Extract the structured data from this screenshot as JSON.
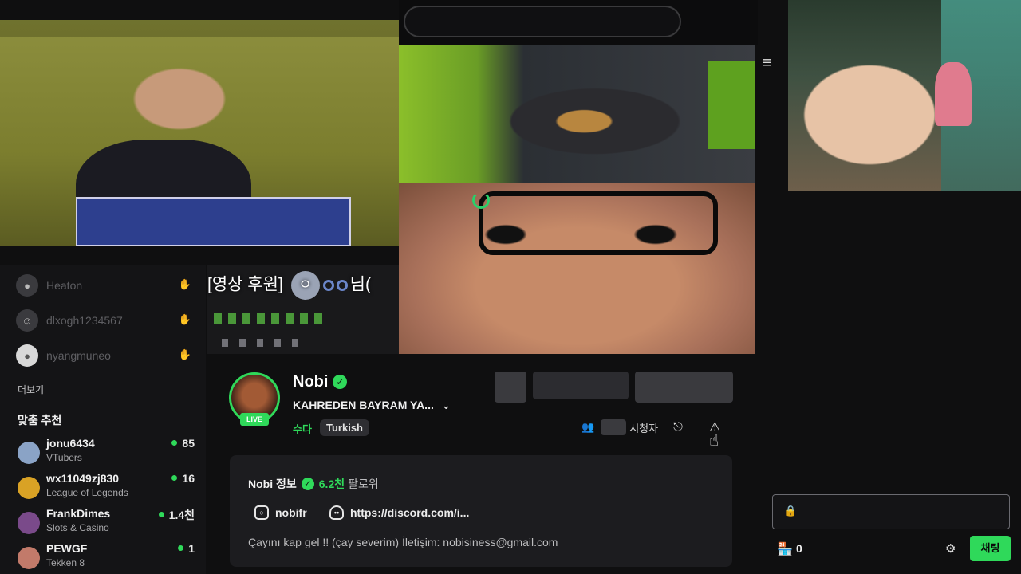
{
  "video": {
    "donation_prefix": "[영상 후원]",
    "donation_circle": "ㅇ",
    "donation_suffix": "님("
  },
  "sidebar": {
    "following": [
      {
        "name": "Heaton"
      },
      {
        "name": "dlxogh1234567"
      },
      {
        "name": "nyangmuneo"
      }
    ],
    "more_label": "더보기",
    "recommended_title": "맞춤 추천",
    "recommended": [
      {
        "name": "jonu6434",
        "category": "VTubers",
        "viewers": "85"
      },
      {
        "name": "wx11049zj830",
        "category": "League of Legends",
        "viewers": "16"
      },
      {
        "name": "FrankDimes",
        "category": "Slots & Casino",
        "viewers": "1.4천"
      },
      {
        "name": "PEWGF",
        "category": "Tekken 8",
        "viewers": "1"
      }
    ]
  },
  "channel": {
    "name": "Nobi",
    "live_badge": "LIVE",
    "stream_title": "KAHREDEN BAYRAM YA...",
    "category": "수다",
    "tag": "Turkish",
    "viewer_label": "시청자"
  },
  "about": {
    "title": "Nobi 정보",
    "followers": "6.2천",
    "followers_label": "팔로워",
    "instagram": "nobifr",
    "discord": "https://discord.com/i...",
    "bio": "Çayını kap gel !! (çay severim) İletişim: nobisiness@gmail.com"
  },
  "chat": {
    "store_count": "0",
    "send_label": "채팅"
  },
  "colors": {
    "accent": "#2fd95a",
    "background": "#0f0f10",
    "panel": "#1c1c1f"
  }
}
